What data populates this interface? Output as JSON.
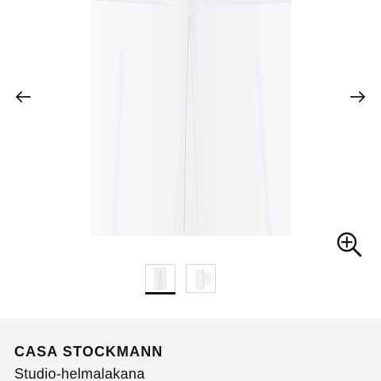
{
  "gallery": {
    "prev_icon": "arrow-left-icon",
    "next_icon": "arrow-right-icon",
    "zoom_icon": "magnifier-plus-icon",
    "image_count": 2,
    "active_index": 1
  },
  "product": {
    "brand": "CASA STOCKMANN",
    "name": "Studio-helmalakana"
  },
  "colors": {
    "underline": "#111111",
    "info_background": "#f3f4f6",
    "image_background": "#f4f5f7"
  }
}
